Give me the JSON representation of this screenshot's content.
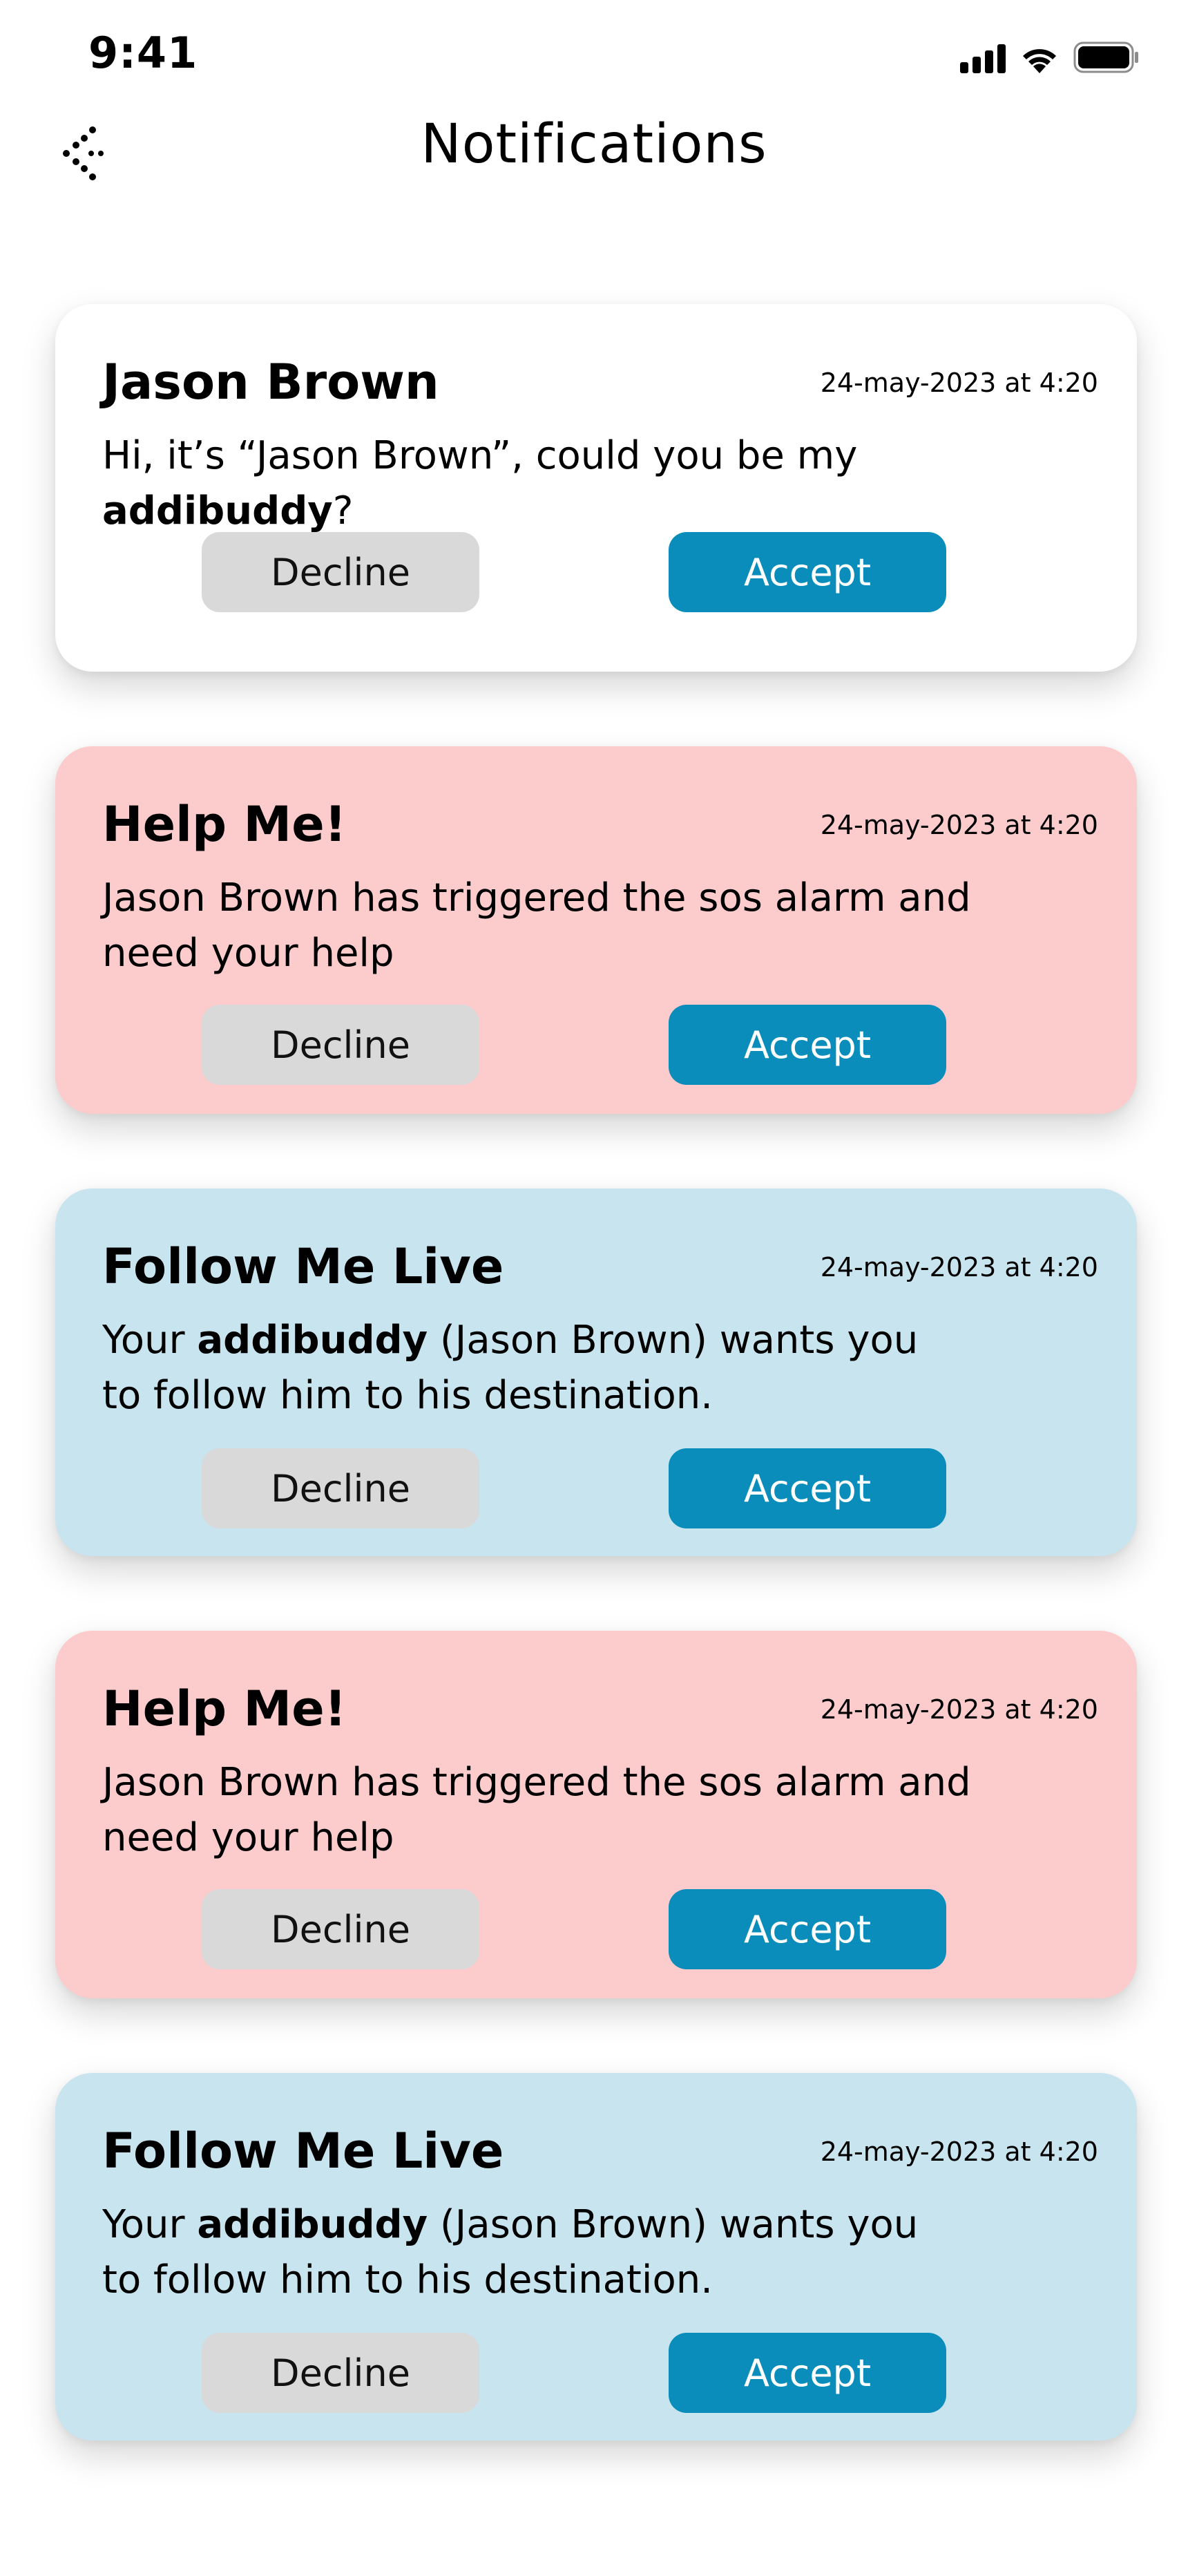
{
  "status_bar": {
    "time": "9:41"
  },
  "header": {
    "title": "Notifications"
  },
  "colors": {
    "white_card": "#ffffff",
    "alert_card": "#fccbcc",
    "info_card": "#c8e4ef",
    "accept": "#0a8dbb",
    "decline": "#d9d9d9"
  },
  "notifications": [
    {
      "title": "Jason Brown",
      "date": "24-may-2023 at 4:20",
      "body_pre": "Hi, it’s “Jason Brown”, could you be my ",
      "body_bold": "addibuddy",
      "body_post": "?",
      "decline_label": "Decline",
      "accept_label": "Accept"
    },
    {
      "title": "Help Me!",
      "date": "24-may-2023 at 4:20",
      "body_line1": "Jason Brown has triggered the sos alarm and",
      "body_line2": "need your help",
      "decline_label": "Decline",
      "accept_label": "Accept"
    },
    {
      "title": "Follow Me Live",
      "date": "24-may-2023 at 4:20",
      "body_pre": "Your ",
      "body_bold": "addibuddy",
      "body_post": " (Jason Brown) wants you",
      "body_line2": "to follow him to his destination.",
      "decline_label": "Decline",
      "accept_label": "Accept"
    },
    {
      "title": "Help Me!",
      "date": "24-may-2023 at 4:20",
      "body_line1": "Jason Brown has triggered the sos alarm and",
      "body_line2": "need your help",
      "decline_label": "Decline",
      "accept_label": "Accept"
    },
    {
      "title": "Follow Me Live",
      "date": "24-may-2023 at 4:20",
      "body_pre": "Your ",
      "body_bold": "addibuddy",
      "body_post": " (Jason Brown) wants you",
      "body_line2": "to follow him to his destination.",
      "decline_label": "Decline",
      "accept_label": "Accept"
    }
  ]
}
